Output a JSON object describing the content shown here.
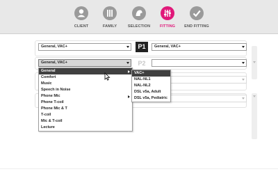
{
  "nav": {
    "items": [
      {
        "label": "CLIENT",
        "icon": "client-icon",
        "active": false
      },
      {
        "label": "FAMILY",
        "icon": "family-icon",
        "active": false
      },
      {
        "label": "SELECTION",
        "icon": "selection-icon",
        "active": false
      },
      {
        "label": "FITTING",
        "icon": "fitting-icon",
        "active": true
      },
      {
        "label": "END FITTING",
        "icon": "end-fitting-icon",
        "active": false
      }
    ],
    "accent": "#e0197a"
  },
  "programs": {
    "p1": {
      "badge": "P1",
      "left_value": "General, VAC+",
      "right_value": "General, VAC+"
    },
    "p2": {
      "badge": "P2",
      "left_value": "General, VAC+",
      "right_value": ""
    }
  },
  "environment_menu": {
    "items": [
      "General",
      "Comfort",
      "Music",
      "Speech in Noise",
      "Phone Mic",
      "Phone T-coil",
      "Phone Mic & T",
      "T-coil",
      "Mic & T-coil",
      "Lecture"
    ],
    "highlighted": "General"
  },
  "rationale_menu": {
    "items": [
      "VAC+",
      "NAL-NL1",
      "NAL-NL2",
      "DSL v5a, Adult",
      "DSL v5a, Pediatric"
    ],
    "highlighted": "VAC+"
  }
}
